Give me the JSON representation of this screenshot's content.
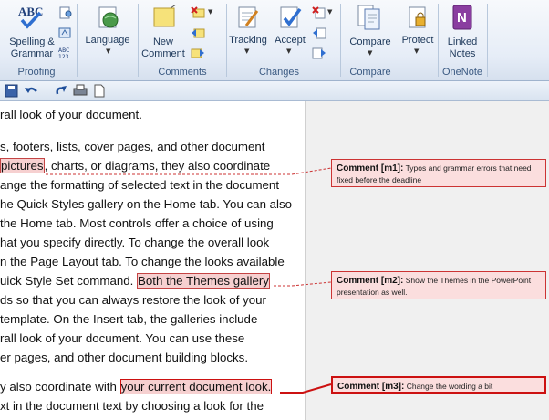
{
  "ribbon": {
    "proofing": {
      "spelling_label_1": "Spelling &",
      "spelling_label_2": "Grammar",
      "group_label": "Proofing"
    },
    "language": {
      "label": "Language"
    },
    "comments": {
      "new_comment_1": "New",
      "new_comment_2": "Comment",
      "group_label": "Comments"
    },
    "changes": {
      "tracking": "Tracking",
      "accept": "Accept",
      "group_label": "Changes"
    },
    "compare": {
      "compare": "Compare",
      "group_label": "Compare"
    },
    "protect": {
      "label": "Protect"
    },
    "onenote": {
      "linked_1": "Linked",
      "linked_2": "Notes",
      "group_label": "OneNote"
    }
  },
  "document": {
    "lines": [
      "rall look of your document.",
      "s, footers, lists, cover pages, and other document",
      "pictures",
      ", charts, or diagrams, they also coordinate",
      "ange the formatting of selected text in the document",
      "he Quick Styles gallery on the Home tab. You can also",
      "the Home tab. Most controls offer a choice of using",
      "hat you specify directly. To change the overall look",
      "n the Page Layout tab. To change the looks available",
      "uick Style Set command. ",
      "Both the Themes gallery",
      "ds so that you can always restore the look of your",
      " template. On the Insert tab, the galleries include",
      "rall look of your document. You can use these",
      "er pages, and other document building blocks.",
      "y also coordinate with ",
      "your current document look.",
      "xt in the document text by choosing a look for the"
    ]
  },
  "comments": [
    {
      "tag": "Comment [m1]:",
      "text": "Typos and grammar errors that need fixed before the deadline"
    },
    {
      "tag": "Comment [m2]:",
      "text": "Show the Themes in the PowerPoint presentation as well."
    },
    {
      "tag": "Comment [m3]:",
      "text": "Change the wording a bit"
    }
  ],
  "colors": {
    "comment_border": "#cc3333",
    "comment_fill": "#fbdede",
    "ribbon_text": "#1e395b"
  }
}
